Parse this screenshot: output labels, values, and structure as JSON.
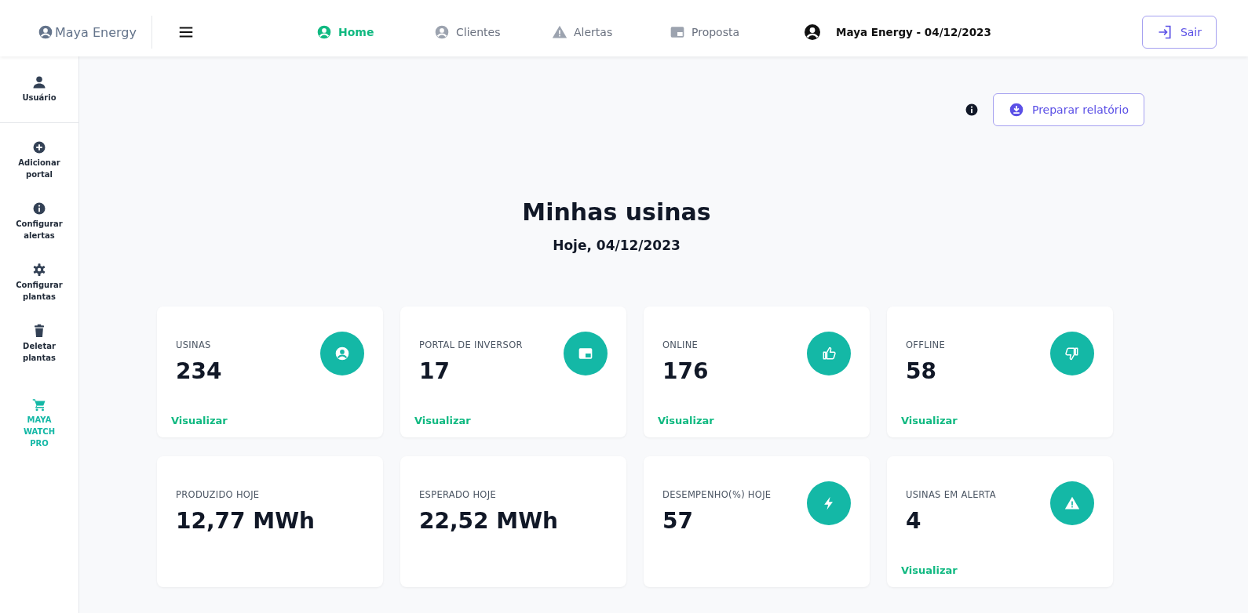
{
  "header": {
    "brand": "Maya Energy",
    "nav": [
      {
        "label": "Home",
        "kind": "user-circle",
        "selected": true
      },
      {
        "label": "Clientes",
        "kind": "user-circle",
        "selected": false
      },
      {
        "label": "Alertas",
        "kind": "warning",
        "selected": false
      },
      {
        "label": "Proposta",
        "kind": "window",
        "selected": false
      }
    ],
    "account": "Maya Energy - 04/12/2023",
    "logout": "Sair"
  },
  "sidebar": {
    "user": "Usuário",
    "items": [
      {
        "label": "Adicionar portal",
        "kind": "plus",
        "highlighted": false
      },
      {
        "label": "Configurar alertas",
        "kind": "info",
        "highlighted": false
      },
      {
        "label": "Configurar plantas",
        "kind": "gear",
        "highlighted": false
      },
      {
        "label": "Deletar plantas",
        "kind": "trash",
        "highlighted": false
      },
      {
        "label": "MAYA WATCH PRO",
        "kind": "cart",
        "highlighted": true
      }
    ]
  },
  "report_button": "Preparar relatório",
  "title": "Minhas usinas",
  "date": "Hoje, 04/12/2023",
  "cards": [
    {
      "label": "USINAS",
      "value": "234",
      "kind": "user-circle",
      "link": "Visualizar"
    },
    {
      "label": "PORTAL DE INVERSOR",
      "value": "17",
      "kind": "window",
      "link": "Visualizar"
    },
    {
      "label": "ONLINE",
      "value": "176",
      "kind": "thumb-up",
      "link": "Visualizar"
    },
    {
      "label": "OFFLINE",
      "value": "58",
      "kind": "thumb-down",
      "link": "Visualizar"
    },
    {
      "label": "PRODUZIDO HOJE",
      "value": "12,77 MWh",
      "kind": "plain"
    },
    {
      "label": "ESPERADO HOJE",
      "value": "22,52 MWh",
      "kind": "plain"
    },
    {
      "label": "DESEMPENHO(%) HOJE",
      "value": "57",
      "kind": "bolt"
    },
    {
      "label": "USINAS EM ALERTA",
      "value": "4",
      "kind": "warning",
      "link": "Visualizar"
    }
  ]
}
